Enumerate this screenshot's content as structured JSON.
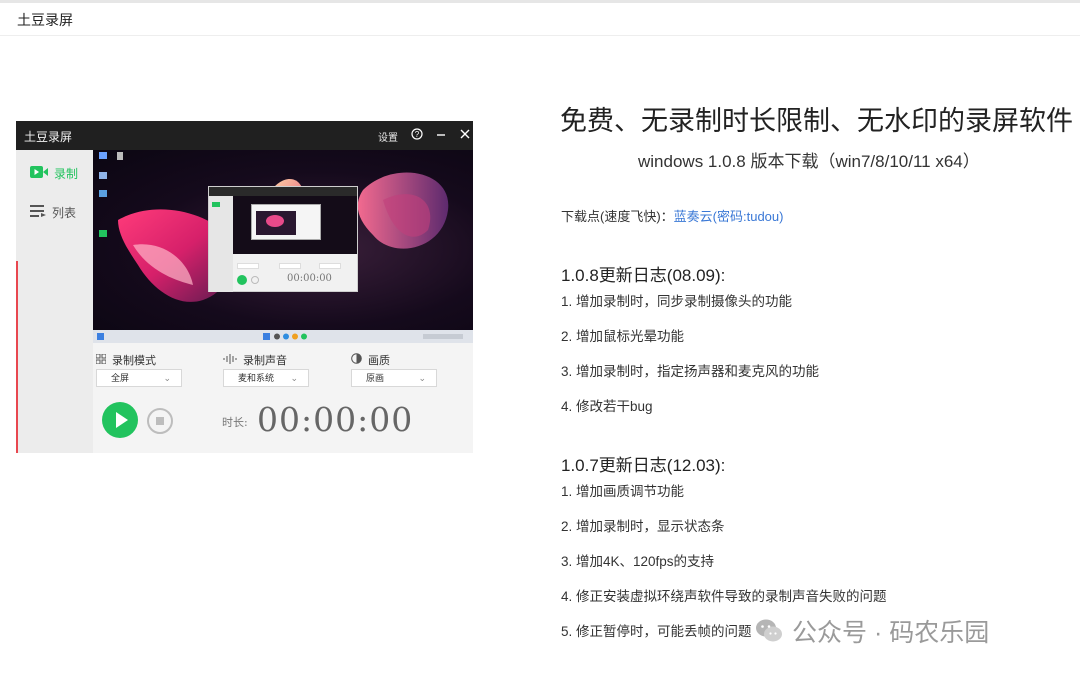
{
  "header": {
    "site_title": "土豆录屏"
  },
  "app_screenshot": {
    "title": "土豆录屏",
    "settings_label": "设置",
    "sidebar": [
      {
        "label": "录制",
        "icon": "video-camera-icon",
        "active": true
      },
      {
        "label": "列表",
        "icon": "list-icon",
        "active": false
      }
    ],
    "controls": {
      "mode_label": "录制模式",
      "mode_value": "全屏",
      "audio_label": "录制声音",
      "audio_value": "麦和系统",
      "quality_label": "画质",
      "quality_value": "原画",
      "duration_label": "时长:",
      "timer": "00:00:00"
    },
    "colors": {
      "accent": "#22c35e",
      "titlebar": "#202020"
    }
  },
  "content": {
    "headline": "免费、无录制时长限制、无水印的录屏软件",
    "subhead": "windows 1.0.8 版本下载（win7/8/10/11 x64）",
    "download_prefix": "下载点(速度飞快)：",
    "download_link": "蓝奏云(密码:tudou)",
    "changelogs": [
      {
        "title": "1.0.8更新日志(08.09):",
        "items": [
          "1. 增加录制时，同步录制摄像头的功能",
          "2. 增加鼠标光晕功能",
          "3. 增加录制时，指定扬声器和麦克风的功能",
          "4. 修改若干bug"
        ]
      },
      {
        "title": "1.0.7更新日志(12.03):",
        "items": [
          "1. 增加画质调节功能",
          "2. 增加录制时，显示状态条",
          "3. 增加4K、120fps的支持",
          "4. 修正安装虚拟环绕声软件导致的录制声音失败的问题",
          "5. 修正暂停时，可能丢帧的问题"
        ]
      }
    ],
    "link_color": "#3a78d6"
  },
  "watermark": {
    "text": "公众号 · 码农乐园"
  }
}
